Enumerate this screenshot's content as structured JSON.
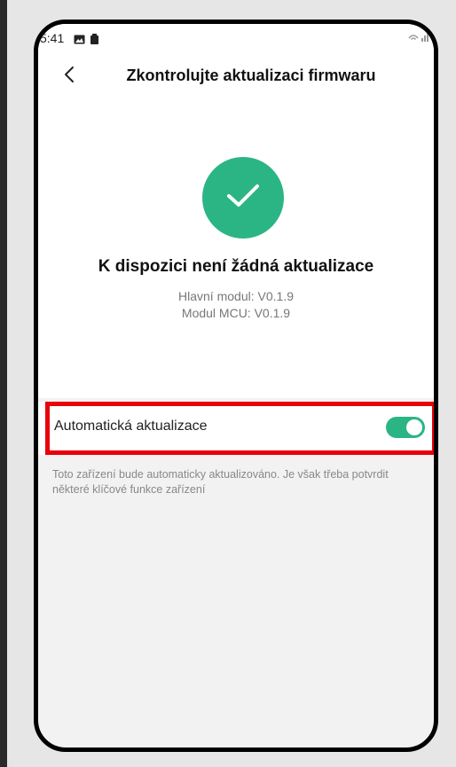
{
  "status_bar": {
    "time": "5:41",
    "left_icons": [
      "image-icon",
      "battery-icon"
    ],
    "right_icons": [
      "wifi-icon",
      "signal-icon"
    ]
  },
  "header": {
    "back_icon": "chevron-left-icon",
    "title": "Zkontrolujte aktualizaci firmwaru"
  },
  "status": {
    "icon": "check-icon",
    "heading": "K dispozici není žádná aktualizace",
    "modules": [
      "Hlavní modul: V0.1.9",
      "Modul MCU: V0.1.9"
    ]
  },
  "auto_update": {
    "label": "Automatická aktualizace",
    "enabled": true,
    "description": "Toto zařízení bude automaticky aktualizováno. Je však třeba potvrdit některé klíčové funkce zařízení"
  },
  "colors": {
    "accent": "#2bb585",
    "highlight": "#e8000b"
  }
}
